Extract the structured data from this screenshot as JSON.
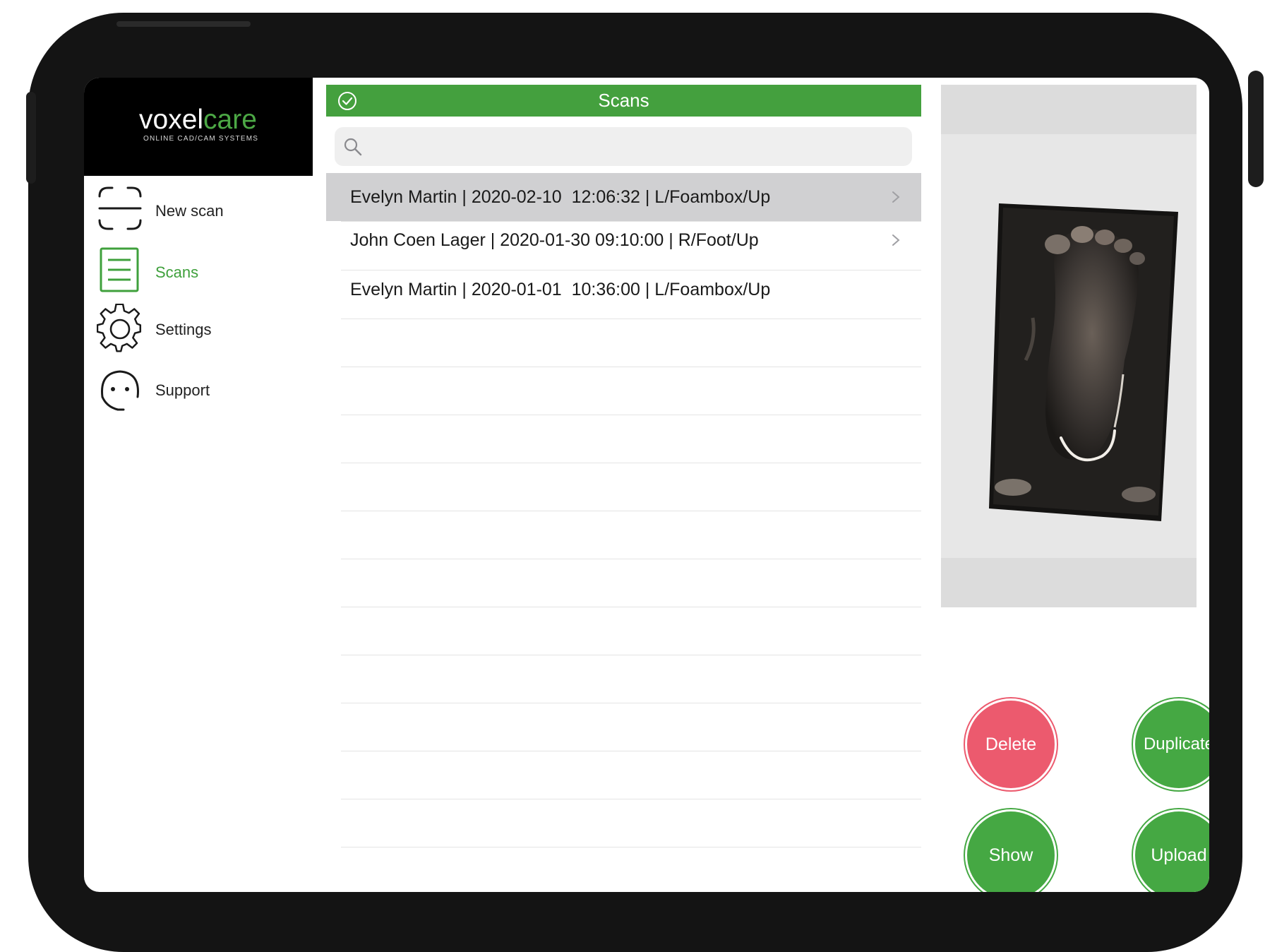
{
  "brand": {
    "name_part1": "voxel",
    "name_part2": "care",
    "tagline": "ONLINE CAD/CAM SYSTEMS",
    "accent_color": "#4ca845"
  },
  "sidebar": {
    "items": [
      {
        "label": "New scan",
        "icon": "scan-frame-icon",
        "active": false
      },
      {
        "label": "Scans",
        "icon": "list-document-icon",
        "active": true
      },
      {
        "label": "Settings",
        "icon": "gear-icon",
        "active": false
      },
      {
        "label": "Support",
        "icon": "headset-icon",
        "active": false
      }
    ]
  },
  "header": {
    "title": "Scans",
    "icon": "check-circle-icon",
    "color": "#44a03e"
  },
  "search": {
    "placeholder": "",
    "value": "",
    "icon": "search-icon"
  },
  "scans": {
    "rows": [
      {
        "text": "Evelyn Martin | 2020-02-10  12:06:32 | L/Foambox/Up",
        "selected": true,
        "chevron": true
      },
      {
        "text": "John Coen Lager | 2020-01-30 09:10:00 | R/Foot/Up",
        "selected": false,
        "chevron": true
      },
      {
        "text": "Evelyn Martin | 2020-01-01  10:36:00 | L/Foambox/Up",
        "selected": false,
        "chevron": false
      }
    ]
  },
  "preview": {
    "image": "foot-scan-preview"
  },
  "actions": {
    "delete": "Delete",
    "duplicate": "Duplicate",
    "show": "Show",
    "upload": "Upload",
    "delete_color": "#ec5a6e",
    "primary_color": "#45a843"
  }
}
